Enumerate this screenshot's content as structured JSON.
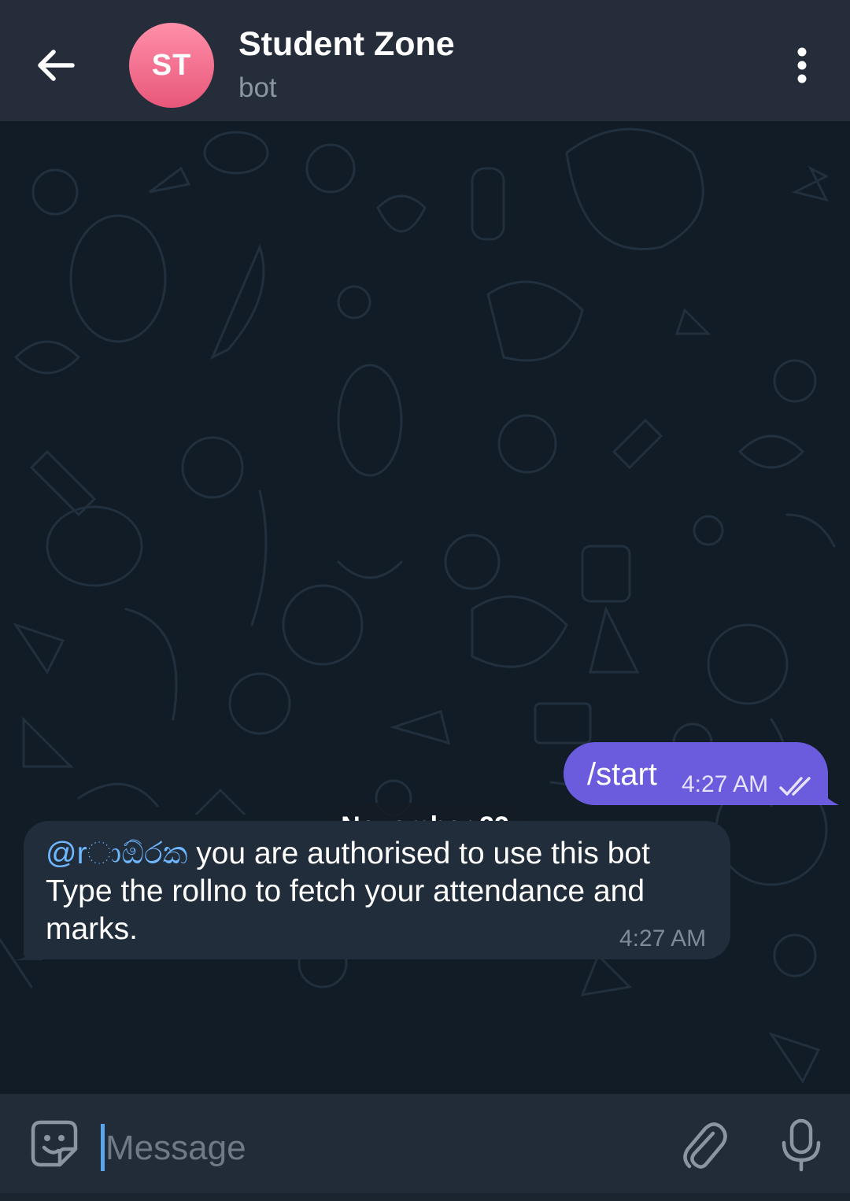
{
  "header": {
    "avatar_initials": "ST",
    "title": "Student Zone",
    "subtitle": "bot",
    "back_icon": "arrow-left-icon",
    "menu_icon": "more-vertical-icon"
  },
  "chat": {
    "date": "November 22",
    "outgoing": {
      "text": "/start",
      "time": "4:27 AM",
      "status_icon": "double-check-icon"
    },
    "incoming": {
      "mention": "@rාඕරක",
      "text_line1": " you are authorised to use this bot",
      "text_line2": "Type the rollno to fetch your attendance and",
      "text_line3": "marks.",
      "time": "4:27 AM"
    }
  },
  "input": {
    "placeholder": "Message",
    "sticker_icon": "sticker-smile-icon",
    "attach_icon": "paperclip-icon",
    "mic_icon": "microphone-icon"
  },
  "colors": {
    "header_bg": "#242d39",
    "chat_bg": "#111c27",
    "outgoing_bubble": "#6a5cdc",
    "incoming_bubble": "#212d3b",
    "avatar": "#f06b8e",
    "mention": "#6fb7ff"
  }
}
